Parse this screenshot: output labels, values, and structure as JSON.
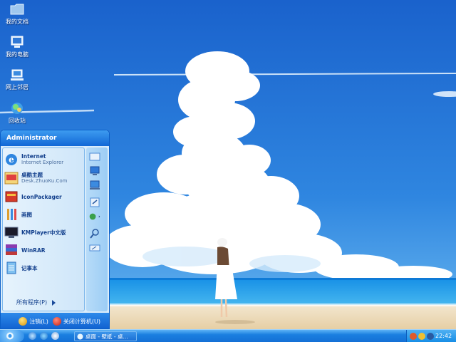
{
  "desktop": {
    "icons": [
      {
        "label": "我的文档",
        "icon": "folder-icon"
      },
      {
        "label": "我的电脑",
        "icon": "computer-icon"
      },
      {
        "label": "网上邻居",
        "icon": "network-icon"
      },
      {
        "label": "回收站",
        "icon": "recycle-bin-icon"
      }
    ]
  },
  "start_menu": {
    "user": "Administrator",
    "items": [
      {
        "title": "Internet",
        "subtitle": "Internet Explorer",
        "icon": "internet-explorer-icon"
      },
      {
        "title": "桌酷主题",
        "subtitle": "Desk.ZhuoKu.Com",
        "icon": "zhuoku-theme-icon"
      },
      {
        "title": "IconPackager",
        "subtitle": "",
        "icon": "iconpackager-icon"
      },
      {
        "title": "画图",
        "subtitle": "",
        "icon": "paint-icon"
      },
      {
        "title": "KMPlayer中文版",
        "subtitle": "",
        "icon": "kmplayer-icon"
      },
      {
        "title": "WinRAR",
        "subtitle": "",
        "icon": "winrar-icon"
      },
      {
        "title": "记事本",
        "subtitle": "",
        "icon": "notepad-icon"
      }
    ],
    "all_programs": "所有程序(P)",
    "logoff": "注销(L)",
    "shutdown": "关闭计算机(U)"
  },
  "taskbar": {
    "task_label": "桌面 - 壁纸 - 桌...",
    "clock": "22:42"
  }
}
